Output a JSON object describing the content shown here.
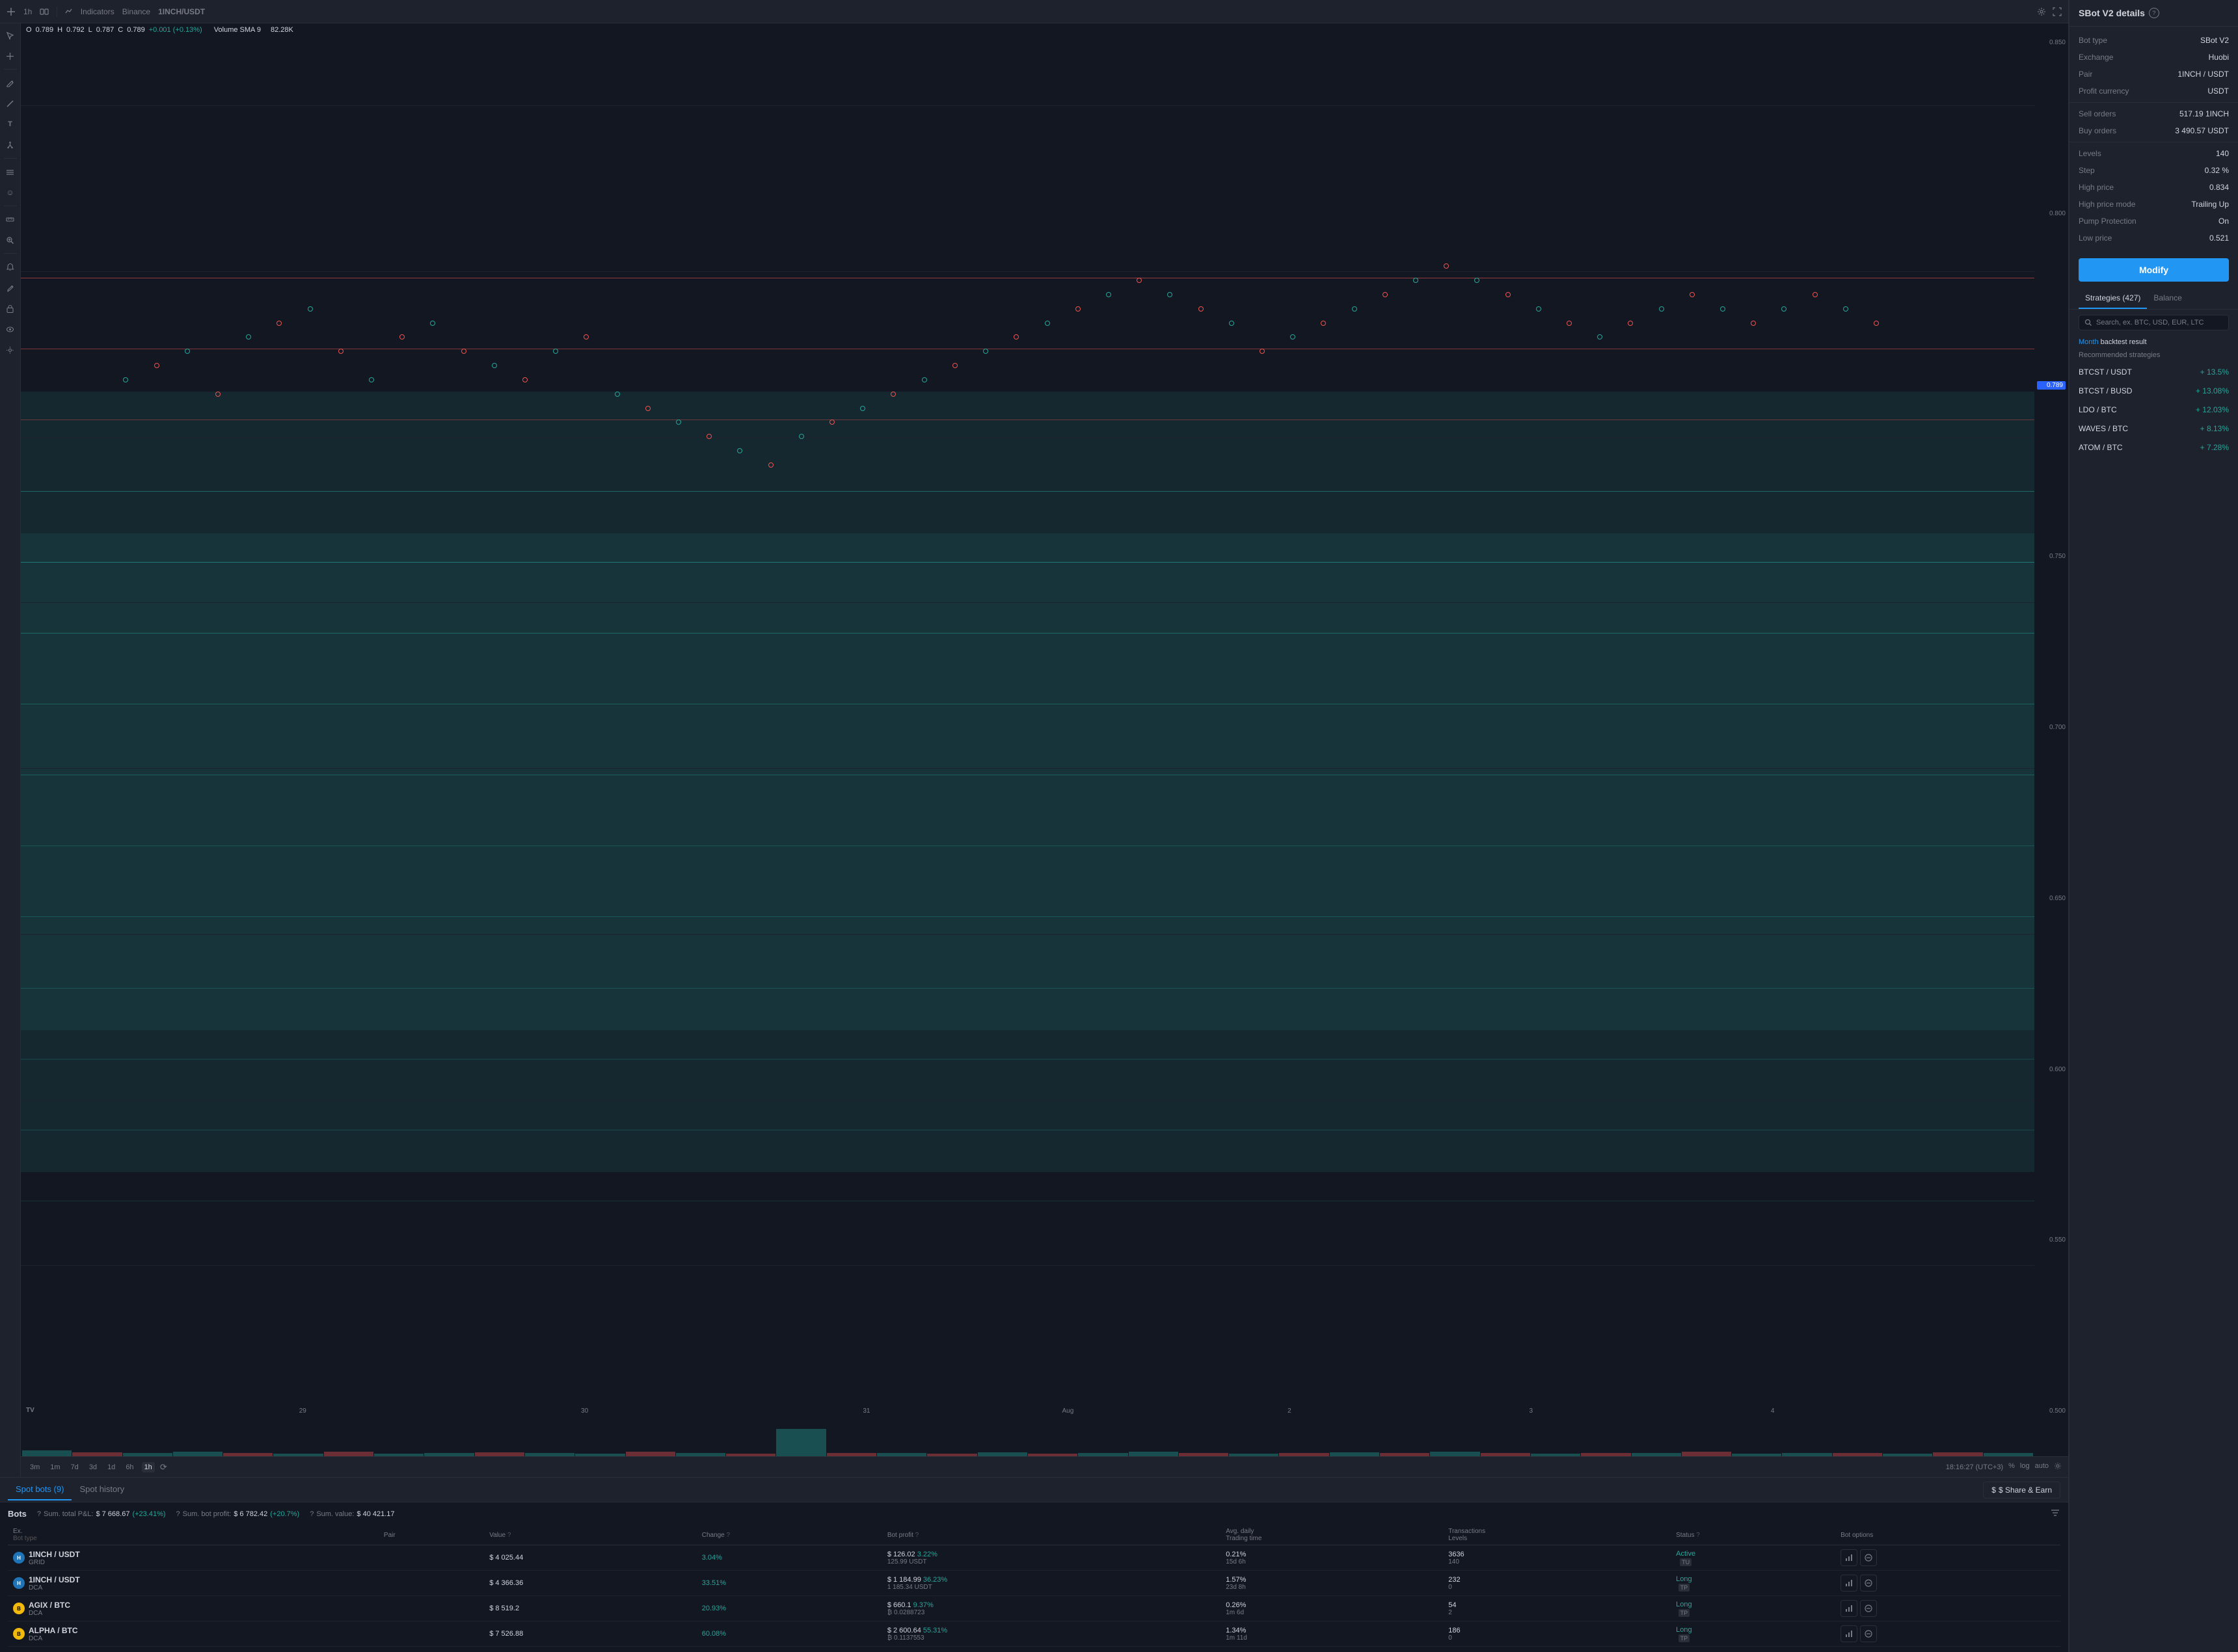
{
  "chart": {
    "timeframe": "1h",
    "compare_icon": "⇄",
    "indicators_label": "Indicators",
    "exchange": "Binance",
    "pair": "1INCH/USDT",
    "ohlc": {
      "open_label": "O",
      "open_val": "0.789",
      "high_label": "H",
      "high_val": "0.792",
      "low_label": "L",
      "low_val": "0.787",
      "close_label": "C",
      "close_val": "0.789",
      "change": "+0.001 (+0.13%)"
    },
    "volume_sma": "Volume SMA 9",
    "volume_sma_val": "82.28K",
    "prices": [
      "0.850",
      "0.800",
      "0.750",
      "0.700",
      "0.650",
      "0.600",
      "0.550",
      "0.500"
    ],
    "current_price": "0.789",
    "time_labels": [
      "29",
      "30",
      "31",
      "Aug",
      "2",
      "3",
      "4"
    ],
    "clock": "18:16:27 (UTC+3)",
    "timeframes": [
      "3m",
      "1m",
      "7d",
      "3d",
      "1d",
      "6h",
      "1h"
    ],
    "active_timeframe": "1h",
    "bottom_opts": [
      "%",
      "log",
      "auto"
    ],
    "settings_icon": "⚙",
    "fullscreen_icon": "⛶",
    "gear_icon": "⚙",
    "lock_icon": "🔒"
  },
  "tabs": {
    "spot_bots": "Spot bots (9)",
    "spot_history": "Spot history",
    "share_earn": "$ Share & Earn"
  },
  "bots": {
    "title": "Bots",
    "stats": [
      {
        "label": "Sum. total P&L:",
        "val": "$ 7 668.67",
        "pct": "(+23.41%)"
      },
      {
        "label": "Sum. bot profit:",
        "val": "$ 6 782.42",
        "pct": "(+20.7%)"
      },
      {
        "label": "Sum. value:",
        "val": "$ 40 421.17"
      }
    ],
    "columns": {
      "ex": "Ex.",
      "pair_bot": "Pair\nBot type",
      "value": "Value ?",
      "change": "Change ?",
      "bot_profit": "Bot profit ?",
      "avg_daily": "Avg. daily\nTrading time",
      "transactions": "Transactions\nLevels",
      "status": "Status ?",
      "bot_options": "Bot options"
    },
    "rows": [
      {
        "exchange": "H",
        "exchange_class": "ex-huobi",
        "pair": "1INCH / USDT",
        "bot_type": "GRID",
        "value": "$ 4 025.44",
        "change": "3.04%",
        "change_class": "green",
        "profit": "$ 126.02",
        "profit_pct": "3.22%",
        "profit_sub": "125.99 USDT",
        "avg_daily": "0.21%",
        "trading_time": "15d 6h",
        "transactions": "3636",
        "levels": "140",
        "status": "Active",
        "status_tag": "TU",
        "status_class": "status-active"
      },
      {
        "exchange": "H",
        "exchange_class": "ex-huobi",
        "pair": "1INCH / USDT",
        "bot_type": "DCA",
        "value": "$ 4 366.36",
        "change": "33.51%",
        "change_class": "green",
        "profit": "$ 1 184.99",
        "profit_pct": "36.23%",
        "profit_sub": "1 185.34 USDT",
        "avg_daily": "1.57%",
        "trading_time": "23d 8h",
        "transactions": "232",
        "levels": "0",
        "status": "Long",
        "status_tag": "TP",
        "status_class": "status-active"
      },
      {
        "exchange": "B",
        "exchange_class": "ex-binance",
        "pair": "AGIX / BTC",
        "bot_type": "DCA",
        "value": "$ 8 519.2",
        "change": "20.93%",
        "change_class": "green",
        "profit": "$ 660.1",
        "profit_pct": "9.37%",
        "profit_sub": "₿ 0.0288723",
        "avg_daily": "0.26%",
        "trading_time": "1m 6d",
        "transactions": "54",
        "levels": "2",
        "status": "Long",
        "status_tag": "TP",
        "status_class": "status-active"
      },
      {
        "exchange": "B",
        "exchange_class": "ex-binance",
        "pair": "ALPHA / BTC",
        "bot_type": "DCA",
        "value": "$ 7 526.88",
        "change": "60.08%",
        "change_class": "green",
        "profit": "$ 2 600.64",
        "profit_pct": "55.31%",
        "profit_sub": "₿ 0.1137553",
        "avg_daily": "1.34%",
        "trading_time": "1m 11d",
        "transactions": "186",
        "levels": "0",
        "status": "Long",
        "status_tag": "TP",
        "status_class": "status-active"
      }
    ]
  },
  "sbot": {
    "title": "SBot V2 details",
    "help": "?",
    "details": [
      {
        "label": "Bot type",
        "value": "SBot V2"
      },
      {
        "label": "Exchange",
        "value": "Huobi"
      },
      {
        "label": "Pair",
        "value": "1INCH / USDT"
      },
      {
        "label": "Profit currency",
        "value": "USDT"
      },
      {
        "sep": true
      },
      {
        "label": "Sell orders",
        "value": "517.19 1INCH"
      },
      {
        "label": "Buy orders",
        "value": "3 490.57 USDT"
      },
      {
        "sep": true
      },
      {
        "label": "Levels",
        "value": "140"
      },
      {
        "label": "Step",
        "value": "0.32 %"
      },
      {
        "label": "High price",
        "value": "0.834"
      },
      {
        "label": "High price mode",
        "value": "Trailing Up"
      },
      {
        "label": "Pump Protection",
        "value": "On"
      },
      {
        "label": "Low price",
        "value": "0.521"
      }
    ],
    "modify_btn": "Modify"
  },
  "strategies": {
    "tab_label": "Strategies (427)",
    "balance_tab": "Balance",
    "search_placeholder": "Search, ex. BTC, USD, EUR, LTC",
    "backtest_month": "Month",
    "backtest_label": "backtest result",
    "recommended_label": "Recommended strategies",
    "items": [
      {
        "name": "BTCST / USDT",
        "pct": "+ 13.5%",
        "pct_class": "green"
      },
      {
        "name": "BTCST / BUSD",
        "pct": "+ 13.08%",
        "pct_class": "green"
      },
      {
        "name": "LDO / BTC",
        "pct": "+ 12.03%",
        "pct_class": "green"
      },
      {
        "name": "WAVES / BTC",
        "pct": "+ 8.13%",
        "pct_class": "green"
      },
      {
        "name": "ATOM / BTC",
        "pct": "+ 7.28%",
        "pct_class": "green"
      }
    ]
  },
  "icons": {
    "cross": "+",
    "cursor": "↖",
    "line": "╱",
    "text_tool": "T",
    "fork": "⑂",
    "layers": "≡",
    "emoji": "☺",
    "ruler": "📏",
    "zoom": "🔍",
    "alert": "🔔",
    "pen": "✏",
    "lock": "🔒",
    "eye": "👁",
    "settings_gear": "⚙",
    "fullscreen": "⛶",
    "search_mag": "🔍",
    "chart_bar": "📊",
    "cancel": "⊘",
    "sync": "⟳",
    "filter": "⚙"
  }
}
